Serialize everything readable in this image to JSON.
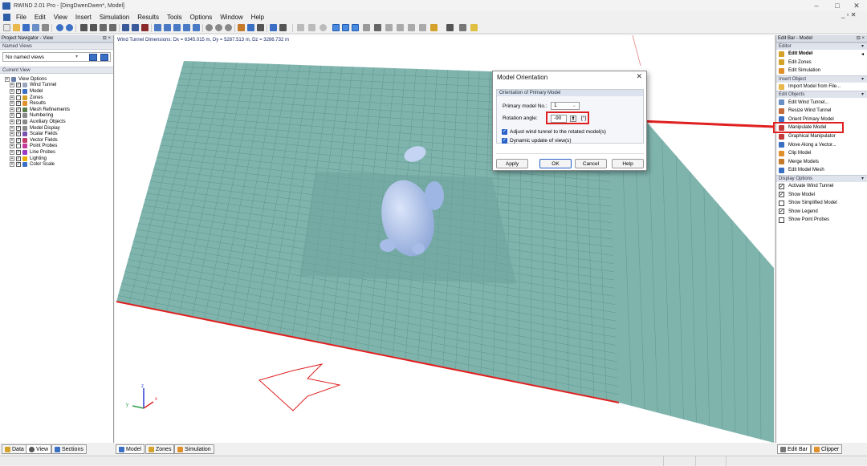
{
  "window": {
    "title": "RWIND 2.01 Pro - [DingDwenDwen*, Model]",
    "controls": [
      "–",
      "□",
      "✕"
    ]
  },
  "menu": {
    "items": [
      "File",
      "Edit",
      "View",
      "Insert",
      "Simulation",
      "Results",
      "Tools",
      "Options",
      "Window",
      "Help"
    ],
    "mdi_controls": "_ ▫ ✕"
  },
  "left_panel": {
    "title": "Project Navigator - View",
    "pin": "⊟ ×",
    "named_views_header": "Named Views",
    "named_views_value": "No named views",
    "current_view_header": "Current View",
    "tree": [
      {
        "label": "View Options",
        "checked": null,
        "color": "#6a7fa8"
      },
      {
        "label": "Wind Tunnel",
        "checked": true,
        "color": "#9aa6bd"
      },
      {
        "label": "Model",
        "checked": true,
        "color": "#3a6fc4"
      },
      {
        "label": "Zones",
        "checked": false,
        "color": "#d4a22a"
      },
      {
        "label": "Results",
        "checked": true,
        "color": "#e0902a"
      },
      {
        "label": "Mesh Refinements",
        "checked": true,
        "color": "#5b7f4a"
      },
      {
        "label": "Numbering",
        "checked": false,
        "color": "#8a8a8a"
      },
      {
        "label": "Auxiliary Objects",
        "checked": true,
        "color": "#8a8a8a"
      },
      {
        "label": "Model Display",
        "checked": true,
        "color": "#8a8a8a"
      },
      {
        "label": "Scalar Fields",
        "checked": true,
        "color": "#7b52b0"
      },
      {
        "label": "Vector Fields",
        "checked": true,
        "color": "#c43a6a"
      },
      {
        "label": "Point Probes",
        "checked": false,
        "color": "#c43a9a"
      },
      {
        "label": "Line Probes",
        "checked": true,
        "color": "#9a3ac4"
      },
      {
        "label": "Lighting",
        "checked": true,
        "color": "#e8b000"
      },
      {
        "label": "Color Scale",
        "checked": true,
        "color": "#3a6fc4"
      }
    ]
  },
  "viewport": {
    "dimensions_text": "Wind Tunnel Dimensions: Dx = 6345.015 m, Dy = 5287.513 m, Dz = 3286.732 m",
    "ground_color": "#7fb4ad",
    "grid_color": "#5e9690",
    "model_color": "#b8cbee",
    "annotation_color": "#e02020",
    "axes": {
      "x": "x",
      "y": "y",
      "z": "z"
    }
  },
  "dialog": {
    "title": "Model Orientation",
    "close": "✕",
    "group_title": "Orientation of Primary Model",
    "primary_model_label": "Primary model No.:",
    "primary_model_value": "1",
    "rotation_label": "Rotation angle:",
    "rotation_value": "-90",
    "rotation_unit": "[°]",
    "check_adjust": "Adjust wind tunnel to the rotated model(s)",
    "check_dynamic": "Dynamic update of view(s)",
    "buttons": {
      "apply": "Apply",
      "ok": "OK",
      "cancel": "Cancel",
      "help": "Help"
    }
  },
  "right_panel": {
    "title": "Edit Bar - Model",
    "pin": "⊟ ×",
    "sections": [
      {
        "title": "Editor",
        "items": [
          {
            "label": "Edit Model",
            "bold": true,
            "color": "#d4a22a"
          },
          {
            "label": "Edit Zones",
            "color": "#d4a22a"
          },
          {
            "label": "Edit Simulation",
            "color": "#e0902a"
          }
        ]
      },
      {
        "title": "Insert Object",
        "items": [
          {
            "label": "Import Model from File...",
            "color": "#e8b84a"
          }
        ]
      },
      {
        "title": "Edit Objects",
        "items": [
          {
            "label": "Edit Wind Tunnel...",
            "color": "#6a8fc4"
          },
          {
            "label": "Resize Wind Tunnel",
            "color": "#c46a3a"
          },
          {
            "label": "Orient Primary Model",
            "color": "#3a6fc4"
          },
          {
            "label": "Manipulate Model",
            "color": "#c43a3a"
          },
          {
            "label": "Graphical Manipulator",
            "color": "#c43a3a"
          },
          {
            "label": "Move Along a Vector...",
            "color": "#3a6fc4"
          },
          {
            "label": "Clip Model",
            "color": "#e0902a"
          },
          {
            "label": "Merge Models",
            "color": "#c47a2a"
          },
          {
            "label": "Edit Model Mesh",
            "color": "#3a6fc4"
          }
        ]
      },
      {
        "title": "Display Options",
        "checks": [
          {
            "label": "Activate Wind Tunnel",
            "checked": true
          },
          {
            "label": "Show Model",
            "checked": true
          },
          {
            "label": "Show Simplified Model",
            "checked": false
          },
          {
            "label": "Show Legend",
            "checked": true
          },
          {
            "label": "Show Point Probes",
            "checked": false
          }
        ]
      }
    ],
    "editor_caret": "◂"
  },
  "bottom_tabs": {
    "left": [
      "Data",
      "View",
      "Sections"
    ],
    "center": [
      "Model",
      "Zones",
      "Simulation"
    ],
    "right": [
      "Edit Bar",
      "Clipper"
    ]
  }
}
